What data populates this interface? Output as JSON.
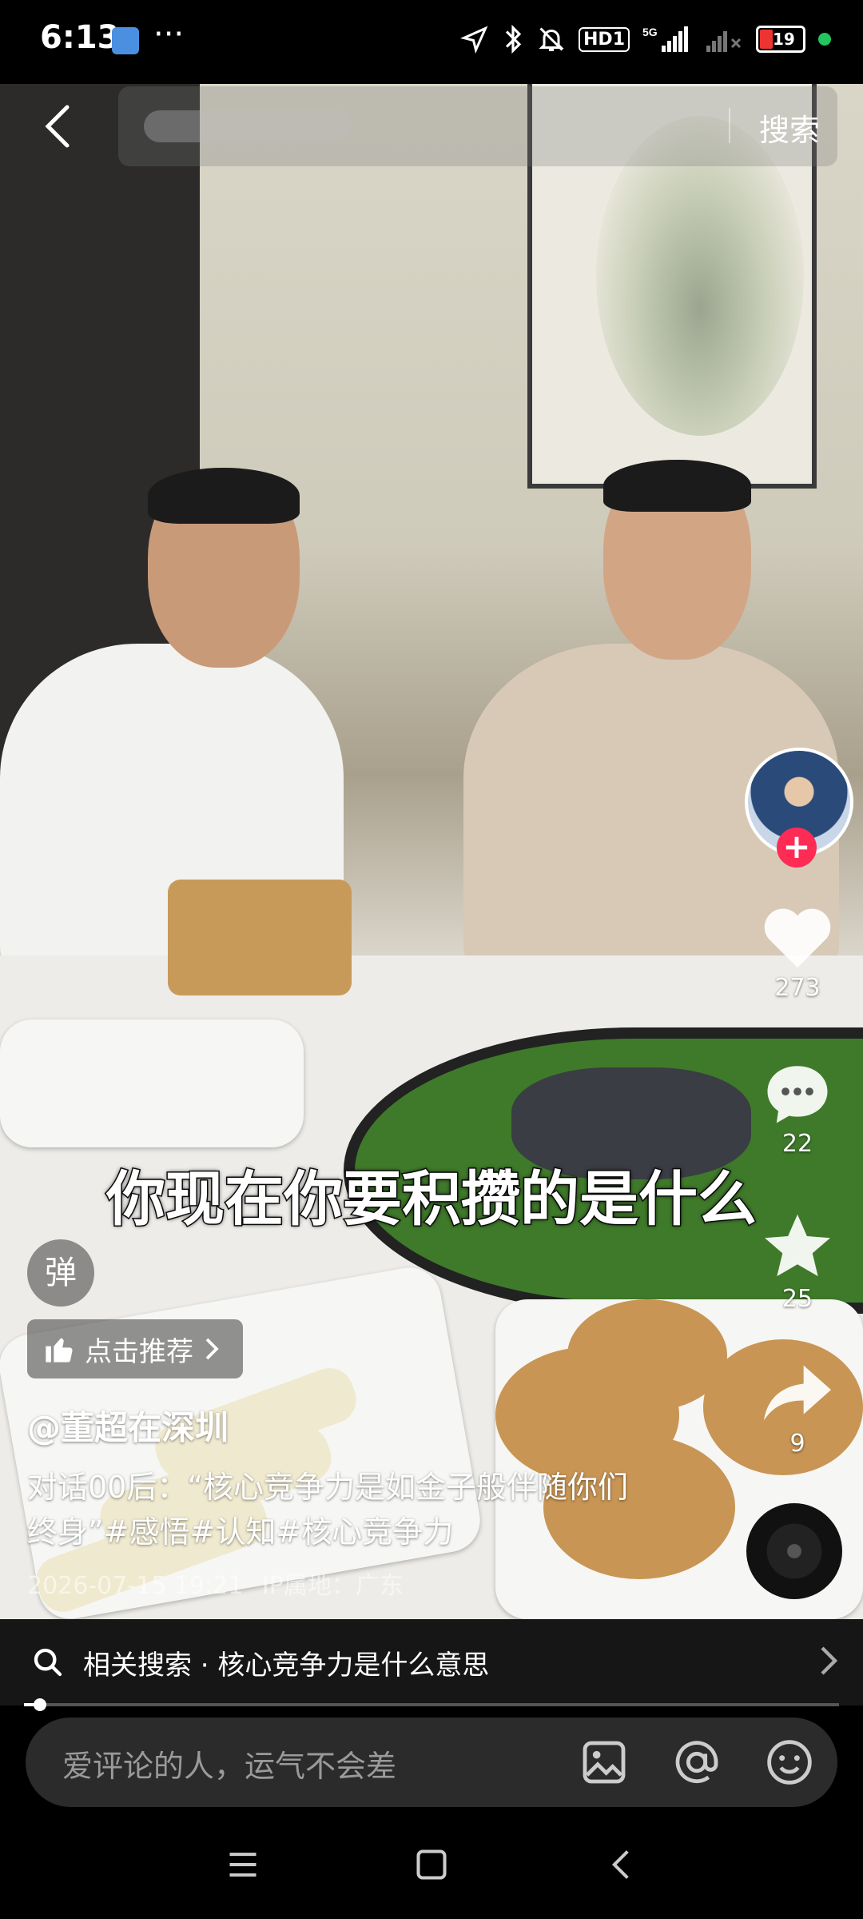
{
  "status_bar": {
    "time": "6:13",
    "more": "···",
    "hd_badge": "HD1",
    "network": "5G",
    "battery": "19"
  },
  "header": {
    "search_button": "搜索"
  },
  "video": {
    "subtitle": "你现在你要积攒的是什么"
  },
  "actions": {
    "likes": "273",
    "comments": "22",
    "favorites": "25",
    "shares": "9"
  },
  "overlay": {
    "danmu_label": "弹",
    "recommend_label": "点击推荐",
    "author": "@董超在深圳",
    "description": "对话00后：“核心竞争力是如金子般伴随你们终身”#感悟#认知#核心竞争力",
    "date": "2026-07-15 19:21",
    "ip_location": "IP属地：广东"
  },
  "related_search": {
    "label": "相关搜索 · 核心竞争力是什么意思"
  },
  "comment_bar": {
    "placeholder": "爱评论的人，运气不会差"
  },
  "progress": {
    "fraction": 0.02
  },
  "colors": {
    "accent": "#fe2c55",
    "background": "#000000"
  }
}
